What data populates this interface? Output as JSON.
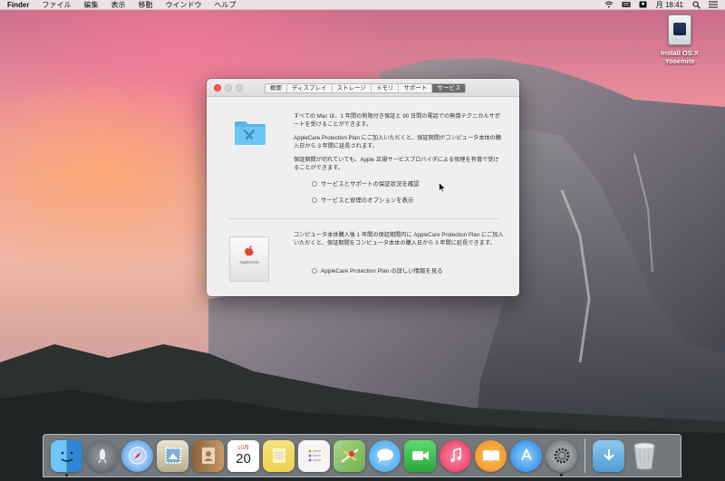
{
  "menubar": {
    "app_name": "Finder",
    "items": [
      "ファイル",
      "編集",
      "表示",
      "移動",
      "ウインドウ",
      "ヘルプ"
    ],
    "clock": "月 18:41",
    "icons": [
      "wifi-icon",
      "keyboard-icon",
      "user-icon"
    ]
  },
  "desktop": {
    "icon_label": "Install OS X Yosemite",
    "icon_label_line1": "Install OS X",
    "icon_label_line2": "Yosemite"
  },
  "window": {
    "tabs": [
      {
        "label": "概要",
        "active": false
      },
      {
        "label": "ディスプレイ",
        "active": false
      },
      {
        "label": "ストレージ",
        "active": false
      },
      {
        "label": "メモリ",
        "active": false
      },
      {
        "label": "サポート",
        "active": false
      },
      {
        "label": "サービス",
        "active": true
      }
    ],
    "para1": "すべての Mac は、1 年間の制限付き保証と 90 日間の電話での無償テクニカルサポートを受けることができます。",
    "para2": "AppleCare Protection Plan にご加入いただくと、保証期間がコンピュータ本体の購入日から 3 年間に延長されます。",
    "para3": "保証期間が切れていても、Apple 正規サービスプロバイダによる修理を有償で受けることができます。",
    "radio1": "サービスとサポートの保証状況を確認",
    "radio2": "サービスと修理のオプションを表示",
    "para4": "コンピュータ本体購入後 1 年間の保証期間内に AppleCare Protection Plan にご加入いただくと、保証期間をコンピュータ本体の購入日から 3 年間に延長できます。",
    "radio3": "AppleCare Protection Plan の詳しい情報を見る",
    "applecare_box_text": "AppleCare"
  },
  "dock": {
    "calendar_month": "10月",
    "calendar_day": "20",
    "items": [
      {
        "name": "finder",
        "color": "#4aa6e8",
        "running": true
      },
      {
        "name": "launchpad",
        "color": "#7a7f88",
        "running": false
      },
      {
        "name": "safari",
        "color": "#3c8ee6",
        "running": false
      },
      {
        "name": "mail",
        "color": "#c7c2b0",
        "running": false
      },
      {
        "name": "contacts",
        "color": "#b58a5a",
        "running": false
      },
      {
        "name": "calendar",
        "color": "#ffffff",
        "running": false
      },
      {
        "name": "notes",
        "color": "#f4e27a",
        "running": false
      },
      {
        "name": "reminders",
        "color": "#f7f7f7",
        "running": false
      },
      {
        "name": "maps",
        "color": "#8fc16e",
        "running": false
      },
      {
        "name": "messages",
        "color": "#5db8f4",
        "running": false
      },
      {
        "name": "facetime",
        "color": "#38c24e",
        "running": false
      },
      {
        "name": "itunes",
        "color": "#f04a6a",
        "running": false
      },
      {
        "name": "ibooks",
        "color": "#f39a2a",
        "running": false
      },
      {
        "name": "app-store",
        "color": "#2b8eea",
        "running": false
      },
      {
        "name": "system-preferences",
        "color": "#7c7f86",
        "running": true
      },
      {
        "name": "downloads",
        "color": "#6fb1df",
        "running": false
      },
      {
        "name": "trash",
        "color": "#d8dde2",
        "running": false
      }
    ]
  }
}
